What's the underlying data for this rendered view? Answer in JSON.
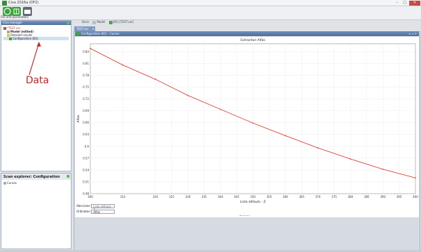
{
  "window": {
    "title": "Civa 2016a (DF2)",
    "controls": [
      "–",
      "□",
      "✕"
    ]
  },
  "toolbar": {
    "caption": "File and parameters",
    "buttons": [
      "check-icon",
      "grid-icon",
      "folder-icon"
    ]
  },
  "menu_tabs": [
    {
      "label": "Deck",
      "icon": "none"
    },
    {
      "label": "Model",
      "icon": "model-icon"
    },
    {
      "label": "[81] [TEST.var]",
      "icon": "green-square-icon"
    }
  ],
  "civa_manager": {
    "title": "Civa manager",
    "tree": [
      {
        "label": "*TEST.var",
        "icon": "file-icon",
        "style": "red"
      },
      {
        "label": "Model (edited)",
        "icon": "node-icon",
        "style": "bold"
      },
      {
        "label": "Detailed results",
        "icon": "folder-icon",
        "style": "normal"
      },
      {
        "label": "Configuration (B1)",
        "icon": "green-icon",
        "style": "selected"
      }
    ]
  },
  "annotation": {
    "text": "Data",
    "color": "#c62828"
  },
  "scan_explorer": {
    "title": "Scan explorer: Configuration",
    "items": [
      "Curves"
    ]
  },
  "document_tab": {
    "label": "TEST.var"
  },
  "config_tab": {
    "label": "Configuration (B1) - Curves"
  },
  "chart_data": {
    "type": "line",
    "title": "Extraction Alfas",
    "xlabel": "Liste défauts - Z",
    "ylabel": "Alfas",
    "xlim": [
      300,
      400
    ],
    "ylim": [
      0.48,
      0.86
    ],
    "xticks": [
      300,
      310,
      320,
      325,
      330,
      335,
      340,
      345,
      350,
      355,
      360,
      365,
      370,
      375,
      380,
      385,
      390,
      395,
      400
    ],
    "yticks": [
      0.48,
      0.51,
      0.54,
      0.57,
      0.6,
      0.63,
      0.66,
      0.69,
      0.72,
      0.75,
      0.78,
      0.81,
      0.84
    ],
    "grid": true,
    "series": [
      {
        "name": "",
        "color": "#e0443a",
        "x": [
          300,
          310,
          320,
          330,
          340,
          350,
          360,
          370,
          380,
          390,
          400
        ],
        "y": [
          0.848,
          0.806,
          0.77,
          0.729,
          0.694,
          0.659,
          0.627,
          0.596,
          0.568,
          0.542,
          0.52
        ]
      }
    ]
  },
  "plot_controls": {
    "abscisses_label": "Abscisses:",
    "abscisses_value": "Liste défauts - Z",
    "ordinates_label": "Ordinates:",
    "ordinates_value": "Alfas"
  }
}
